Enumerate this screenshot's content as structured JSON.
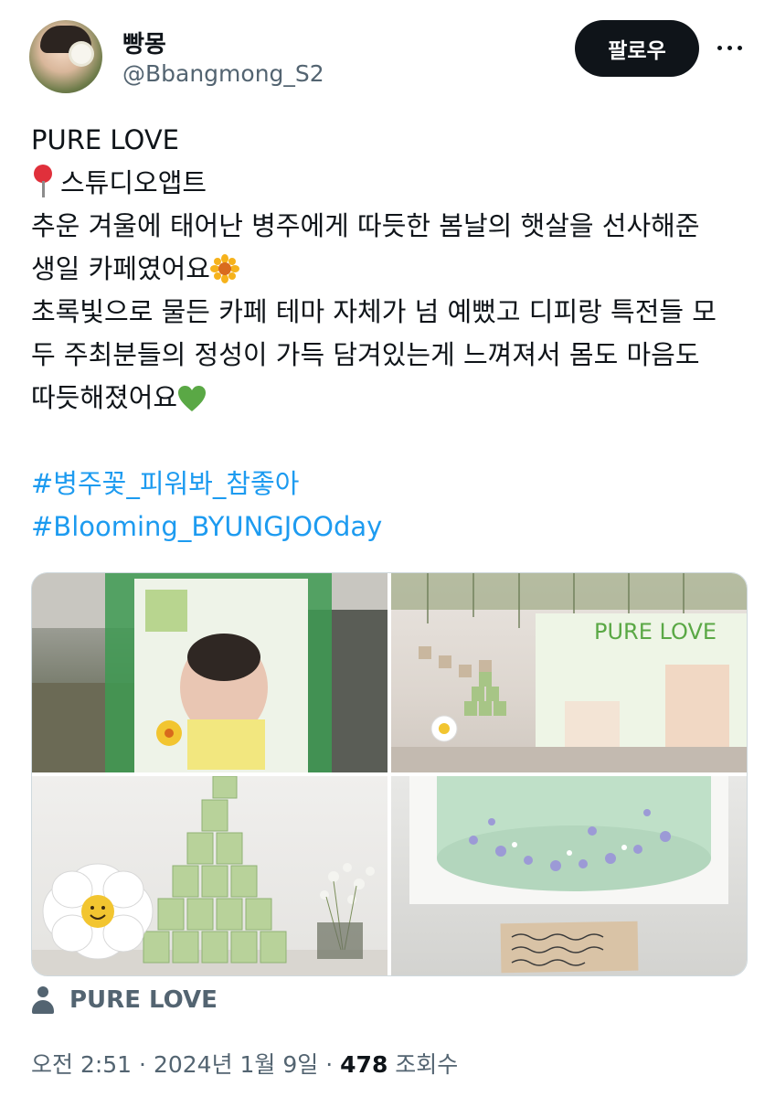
{
  "author": {
    "display_name": "빵몽",
    "handle": "@Bbangmong_S2",
    "follow_label": "팔로우",
    "more_icon": "more-icon"
  },
  "tweet": {
    "lines": [
      "PURE LOVE",
      "스튜디오앱트",
      "추운 겨울에 태어난 병주에게 따듯한 봄날의 햇살을 선사해준",
      "생일 카페였어요",
      "초록빛으로 물든 카페 테마 자체가 넘 예뻤고 디피랑 특전들 모",
      "두 주최분들의 정성이 가득 담겨있는게 느껴져서 몸도 마음도",
      "따듯해졌어요"
    ],
    "hashtags": [
      "#병주꽃_피워봐_참좋아",
      "#Blooming_BYUNGJOOday"
    ],
    "emoji": {
      "pin": "round-pushpin-emoji",
      "sun": "sunflower-emoji",
      "heart": "green-heart-emoji"
    },
    "colors": {
      "hashtag": "#1d9bf0",
      "muted": "#536471",
      "text": "#0f1419"
    }
  },
  "media": {
    "banner_text": "PURE LOVE",
    "photos": [
      "photo-1",
      "photo-2",
      "photo-3",
      "photo-4"
    ]
  },
  "location": {
    "label": "PURE LOVE",
    "icon": "person-location-icon"
  },
  "meta": {
    "time": "오전 2:51",
    "separator": "·",
    "date": "2024년 1월 9일",
    "views_count": "478",
    "views_label": "조회수"
  }
}
